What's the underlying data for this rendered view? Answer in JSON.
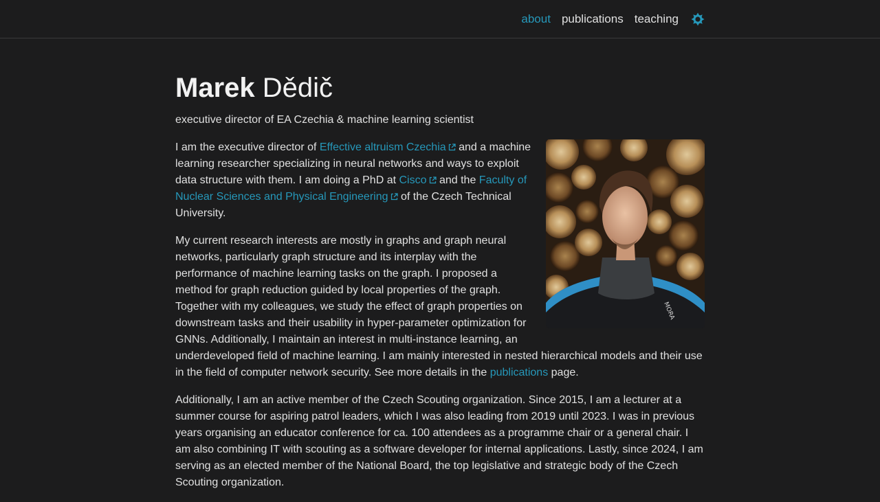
{
  "nav": {
    "items": [
      {
        "label": "about",
        "active": true
      },
      {
        "label": "publications",
        "active": false
      },
      {
        "label": "teaching",
        "active": false
      }
    ],
    "theme_icon": "sun-icon",
    "accent_color": "#2698ba"
  },
  "header": {
    "first_name": "Marek",
    "last_name": "Dědič",
    "subtitle": "executive director of EA Czechia & machine learning scientist"
  },
  "bio": {
    "p1": {
      "t1": "I am the executive director of ",
      "link1": "Effective altruism Czechia",
      "t2": " and a machine learning researcher specializing in neural networks and ways to exploit data structure with them. I am doing a PhD at ",
      "link2": "Cisco",
      "t3": " and the ",
      "link3": "Faculty of Nuclear Sciences and Physical Engineering",
      "t4": " of the Czech Technical University."
    },
    "p2": {
      "t1": "My current research interests are mostly in graphs and graph neural networks, particularly graph structure and its interplay with the performance of machine learning tasks on the graph. I proposed a method for graph reduction guided by local properties of the graph. Together with my colleagues, we study the effect of graph properties on downstream tasks and their usability in hyper-parameter optimization for GNNs. Additionally, I maintain an interest in multi-instance learning, an underdeveloped field of machine learning. I am mainly interested in nested hierarchical models and their use in the field of computer network security. See more details in the ",
      "link": "publications",
      "t2": " page."
    },
    "p3": "Additionally, I am an active member of the Czech Scouting organization. Since 2015, I am a lecturer at a summer course for aspiring patrol leaders, which I was also leading from 2019 until 2023. I was in previous years organising an educator conference for ca. 100 attendees as a programme chair or a general chair. I am also combining IT with scouting as a software developer for internal applications. Lastly, since 2024, I am serving as an elected member of the National Board, the top legislative and strategic body of the Czech Scouting organization.",
    "icons": {
      "external_link": "external-link-icon"
    }
  },
  "photo": {
    "jacket_text": "MORA"
  }
}
